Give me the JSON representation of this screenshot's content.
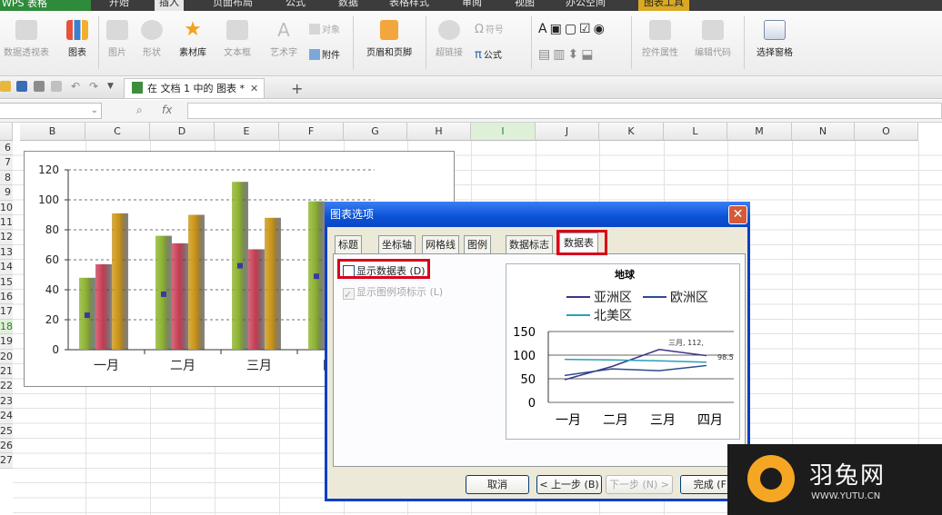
{
  "menu": {
    "app_button": "WPS 表格",
    "items": [
      "开始",
      "插入",
      "页面布局",
      "公式",
      "数据",
      "表格样式",
      "审阅",
      "视图",
      "办公空间",
      "图表工具"
    ],
    "active": "插入"
  },
  "ribbon": {
    "buttons": [
      {
        "label": "数据透视表",
        "icon": "pivot-table-icon",
        "enabled": false
      },
      {
        "label": "图表",
        "icon": "chart-icon",
        "enabled": true
      },
      {
        "label": "图片",
        "icon": "picture-icon",
        "enabled": false
      },
      {
        "label": "形状",
        "icon": "shape-icon",
        "enabled": false
      },
      {
        "label": "素材库",
        "icon": "star-icon",
        "enabled": true
      },
      {
        "label": "文本框",
        "icon": "textbox-icon",
        "enabled": false
      },
      {
        "label": "艺术字",
        "icon": "wordart-icon",
        "enabled": false
      },
      {
        "label": "页眉和页脚",
        "icon": "header-footer-icon",
        "enabled": true
      },
      {
        "label": "超链接",
        "icon": "hyperlink-icon",
        "enabled": false
      },
      {
        "label": "控件属性",
        "icon": "control-properties-icon",
        "enabled": false
      },
      {
        "label": "编辑代码",
        "icon": "edit-code-icon",
        "enabled": false
      },
      {
        "label": "选择窗格",
        "icon": "selection-pane-icon",
        "enabled": true
      }
    ],
    "small_buttons": [
      {
        "label": "对象",
        "enabled": false
      },
      {
        "label": "附件",
        "enabled": true
      },
      {
        "label": "符号",
        "enabled": false
      },
      {
        "label": "公式",
        "enabled": true
      }
    ]
  },
  "doc_tab": {
    "title": "在 文档 1 中的 图表 *",
    "close": "✕",
    "new_tab": "+"
  },
  "formula_bar": {
    "fx": "fx"
  },
  "columns": [
    "B",
    "C",
    "D",
    "E",
    "F",
    "G",
    "H",
    "I",
    "J",
    "K",
    "L",
    "M",
    "N",
    "O"
  ],
  "selected_column": "I",
  "rows": [
    "6",
    "7",
    "8",
    "9",
    "10",
    "11",
    "12",
    "13",
    "14",
    "15",
    "16",
    "17",
    "18",
    "19",
    "20",
    "21",
    "22",
    "23",
    "24",
    "25",
    "26",
    "27"
  ],
  "selected_row": "18",
  "chart_data": [
    {
      "type": "bar",
      "title": "",
      "categories": [
        "一月",
        "二月",
        "三月",
        "四月"
      ],
      "series": [
        {
          "values": [
            48,
            76,
            112,
            99
          ],
          "color": "#8ab12b"
        },
        {
          "values": [
            57,
            71,
            67,
            null
          ],
          "color": "#c63b51"
        },
        {
          "values": [
            91,
            90,
            88,
            null
          ],
          "color": "#c99210"
        },
        {
          "values": [
            23,
            37,
            56,
            49
          ],
          "color": "#3b3a9e"
        }
      ],
      "ylim": [
        0,
        120
      ],
      "yticks": [
        "0",
        "20",
        "40",
        "60",
        "80",
        "100",
        "120"
      ],
      "grid": true,
      "legend": "none"
    },
    {
      "type": "line",
      "title": "地球",
      "categories": [
        "一月",
        "二月",
        "三月",
        "四月"
      ],
      "series": [
        {
          "name": "亚洲区",
          "values": [
            48,
            76,
            112,
            99
          ],
          "color": "#3d3388"
        },
        {
          "name": "欧洲区",
          "values": [
            57,
            71,
            67,
            78
          ],
          "color": "#2d4a8f"
        },
        {
          "name": "北美区",
          "values": [
            91,
            90,
            88,
            85
          ],
          "color": "#2a9fb8"
        }
      ],
      "data_labels": [
        "三月, 112,",
        "98.5"
      ],
      "ylim": [
        0,
        150
      ],
      "yticks": [
        "0",
        "50",
        "100",
        "150"
      ],
      "grid": true,
      "legend": "top"
    }
  ],
  "dialog": {
    "title": "图表选项",
    "close": "✕",
    "tabs": [
      "标题",
      "坐标轴",
      "网格线",
      "图例",
      "数据标志",
      "数据表"
    ],
    "active_tab": "数据表",
    "show_data_table": "显示数据表 (D)",
    "show_legend_keys": "显示图例项标示 (L)",
    "buttons": {
      "cancel": "取消",
      "prev": "< 上一步 (B)",
      "next": "下一步 (N) >",
      "finish": "完成 (F)"
    }
  },
  "watermark": {
    "name": "羽兔网",
    "url": "WWW.YUTU.CN"
  }
}
